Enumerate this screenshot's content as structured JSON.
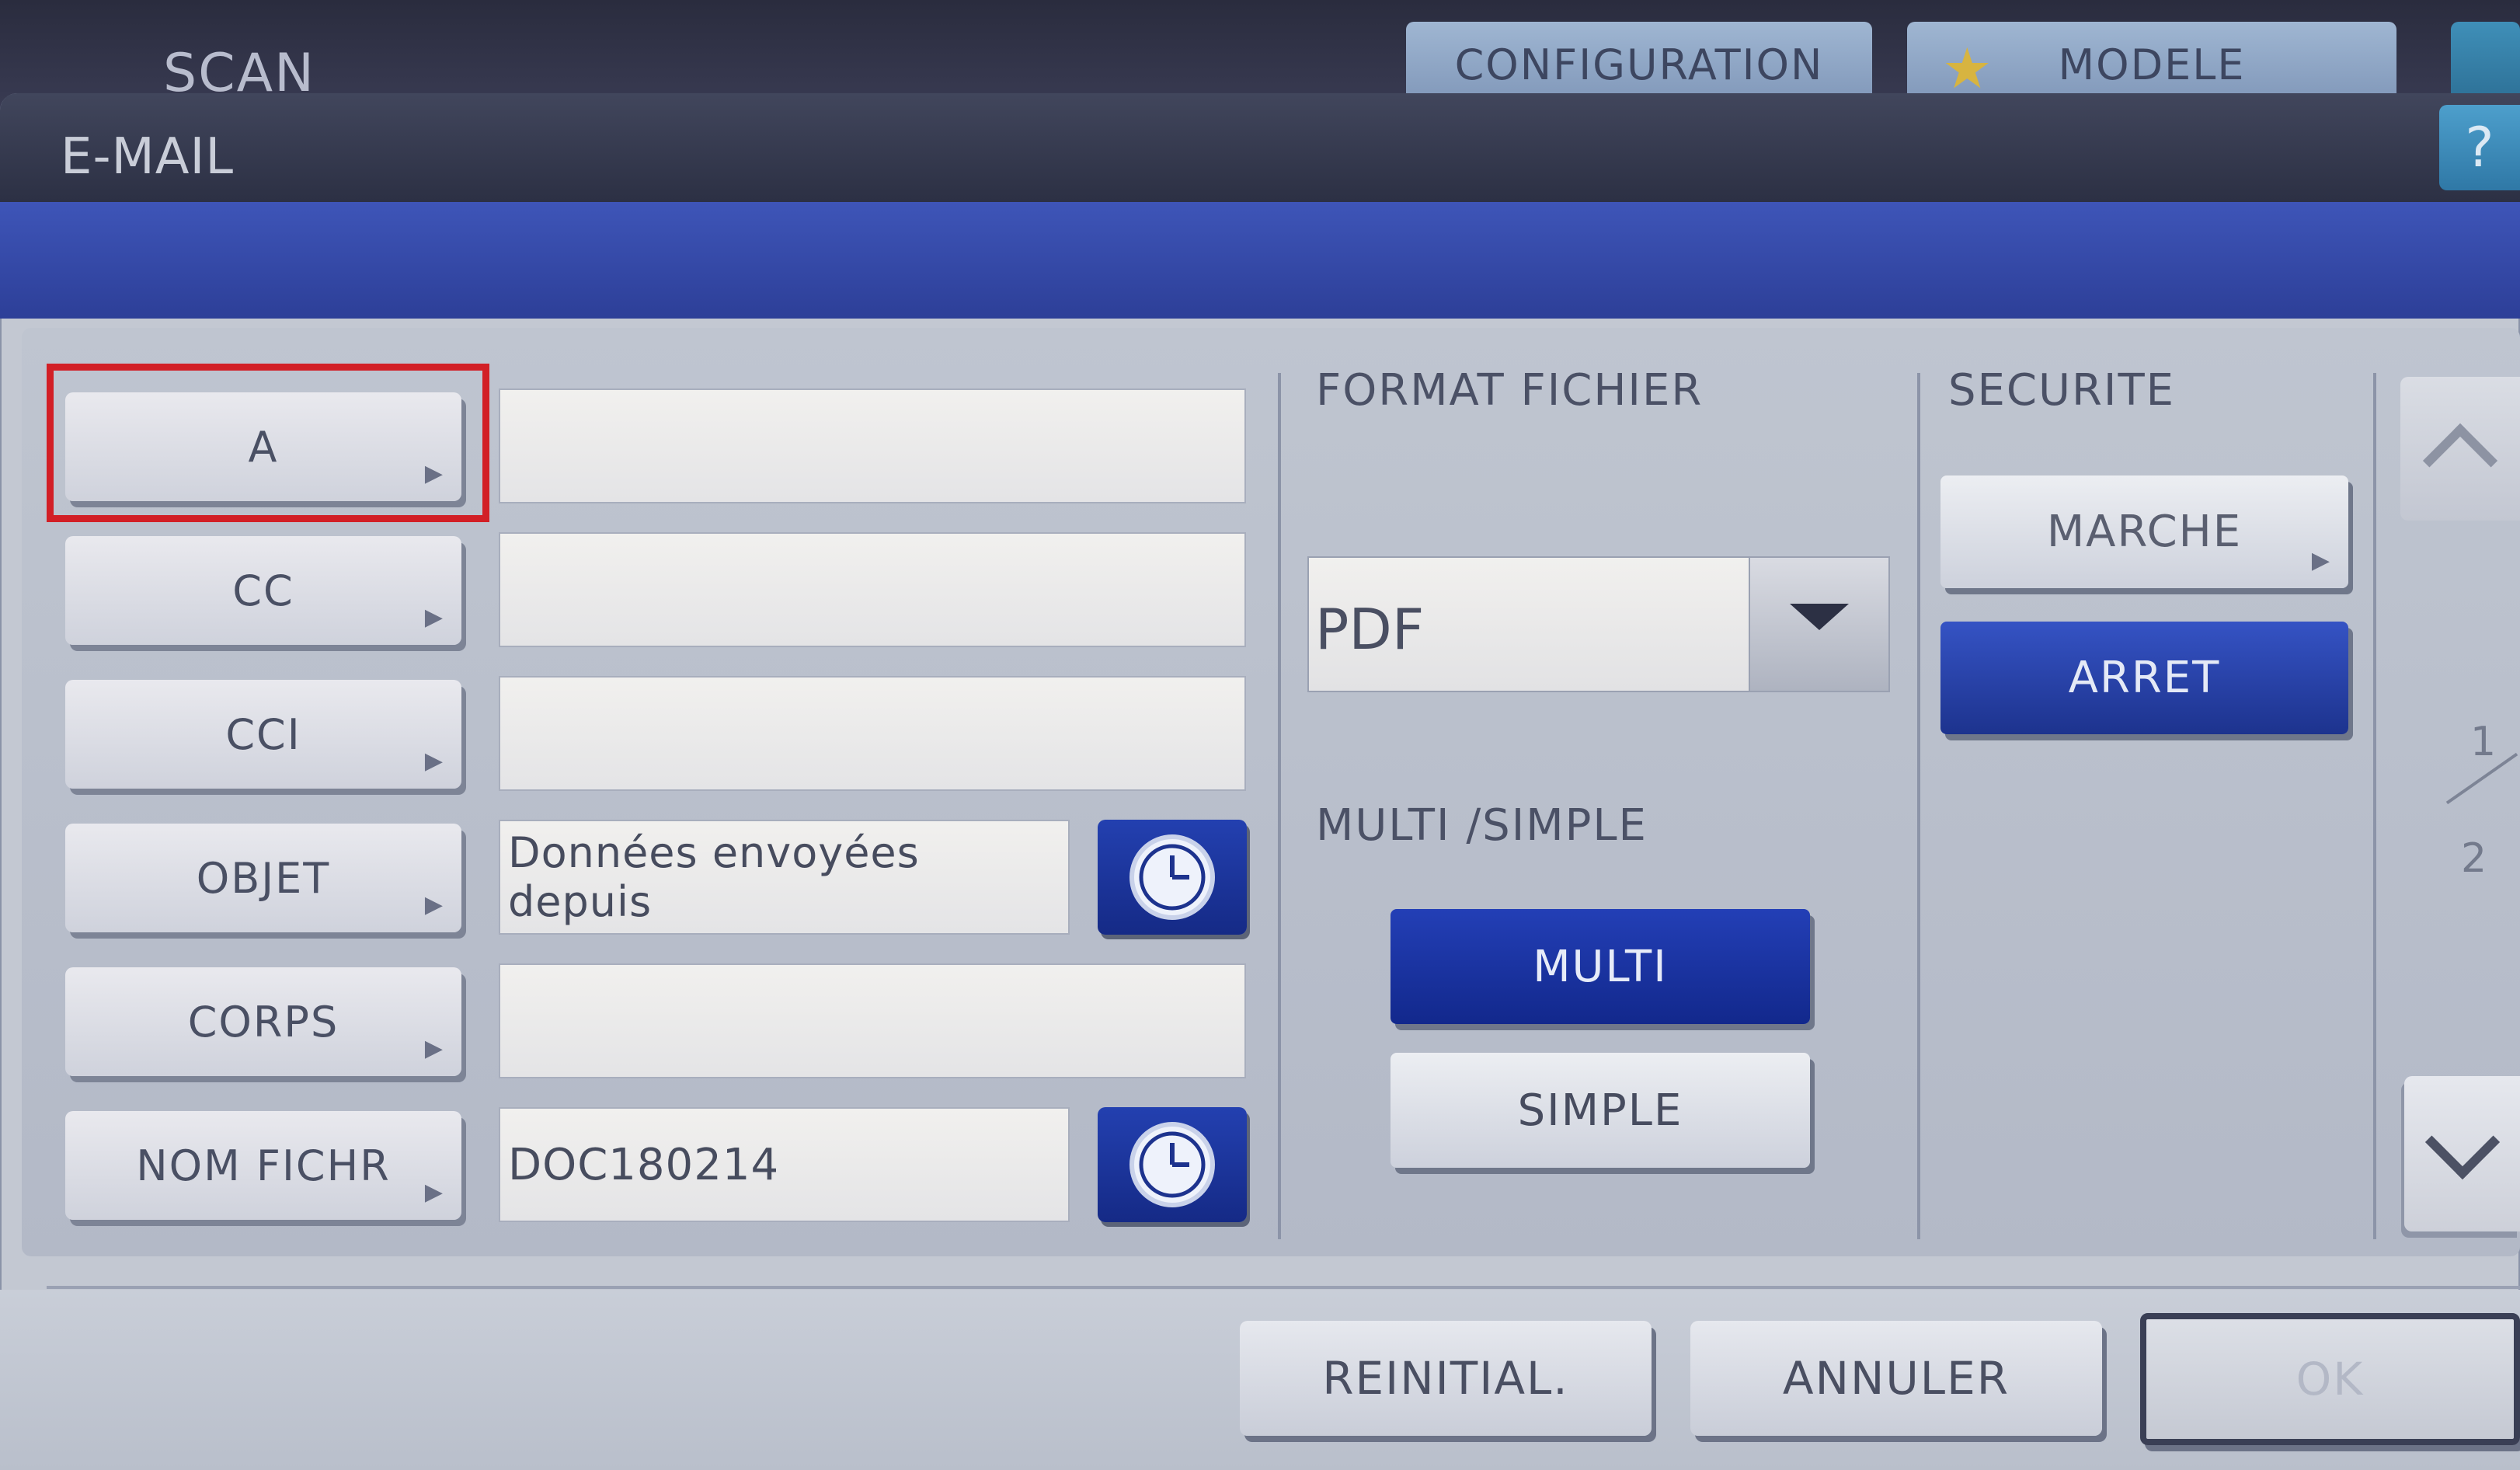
{
  "background": {
    "title": "SCAN",
    "tabs": [
      "CONFIGURATION",
      "MODELE"
    ]
  },
  "dialog": {
    "title": "E-MAIL",
    "help_label": "?"
  },
  "destinations": [
    {
      "label": "A",
      "value": ""
    },
    {
      "label": "CC",
      "value": ""
    },
    {
      "label": "CCI",
      "value": ""
    },
    {
      "label": "OBJET",
      "value": "Données envoyées depuis"
    },
    {
      "label": "CORPS",
      "value": ""
    },
    {
      "label": "NOM FICHR",
      "value": "DOC180214"
    }
  ],
  "format": {
    "label": "FORMAT FICHIER",
    "selected": "PDF"
  },
  "multi_simple": {
    "label": "MULTI /SIMPLE",
    "options": [
      "MULTI",
      "SIMPLE"
    ],
    "selected": "MULTI"
  },
  "securite": {
    "label": "SECURITE",
    "options": [
      "MARCHE",
      "ARRET"
    ],
    "selected": "ARRET"
  },
  "pager": {
    "current": "1",
    "total": "2"
  },
  "footer": {
    "reinit": "REINITIAL.",
    "annuler": "ANNULER",
    "ok": "OK"
  },
  "colors": {
    "accent_blue": "#1d338e",
    "highlight_red": "#d21f26"
  }
}
